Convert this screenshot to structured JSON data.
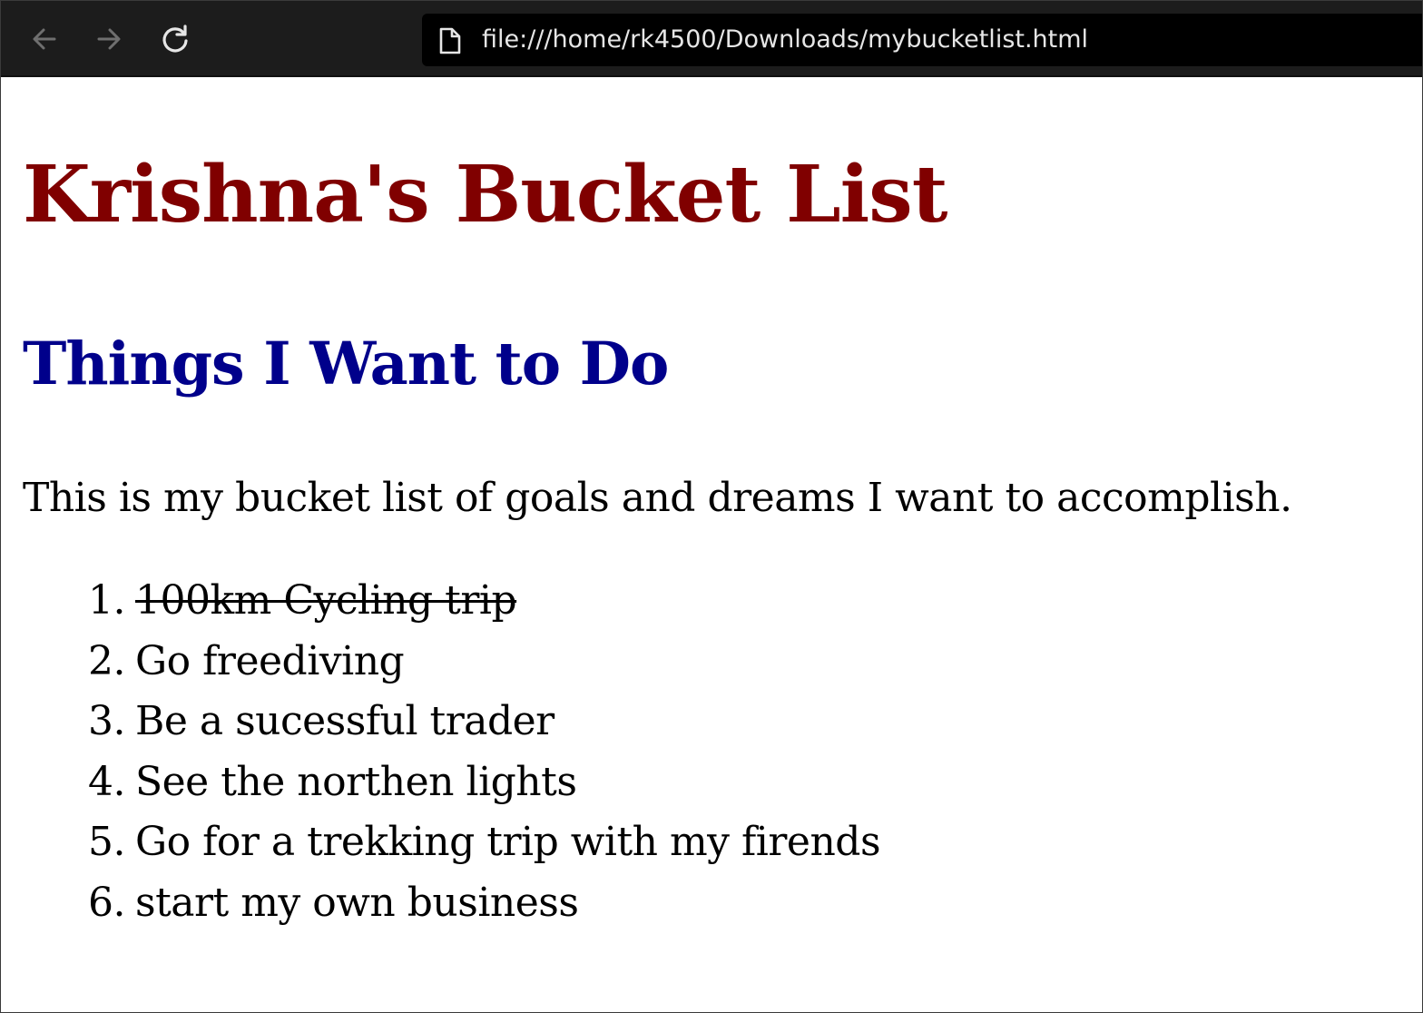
{
  "browser": {
    "url": "file:///home/rk4500/Downloads/mybucketlist.html",
    "icons": {
      "back": "arrow-left-icon",
      "forward": "arrow-right-icon",
      "reload": "reload-icon",
      "page": "file-page-icon"
    }
  },
  "page": {
    "title": "Krishna's Bucket List",
    "title_color": "#800000",
    "subtitle": "Things I Want to Do",
    "subtitle_color": "#00008b",
    "intro": "This is my bucket list of goals and dreams I want to accomplish.",
    "list": [
      {
        "num": "1.",
        "text": "100km Cycling trip",
        "completed": true
      },
      {
        "num": "2.",
        "text": "Go freediving",
        "completed": false
      },
      {
        "num": "3.",
        "text": "Be a sucessful trader",
        "completed": false
      },
      {
        "num": "4.",
        "text": "See the northen lights",
        "completed": false
      },
      {
        "num": "5.",
        "text": "Go for a trekking trip with my firends",
        "completed": false
      },
      {
        "num": "6.",
        "text": "start my own business",
        "completed": false
      }
    ]
  }
}
